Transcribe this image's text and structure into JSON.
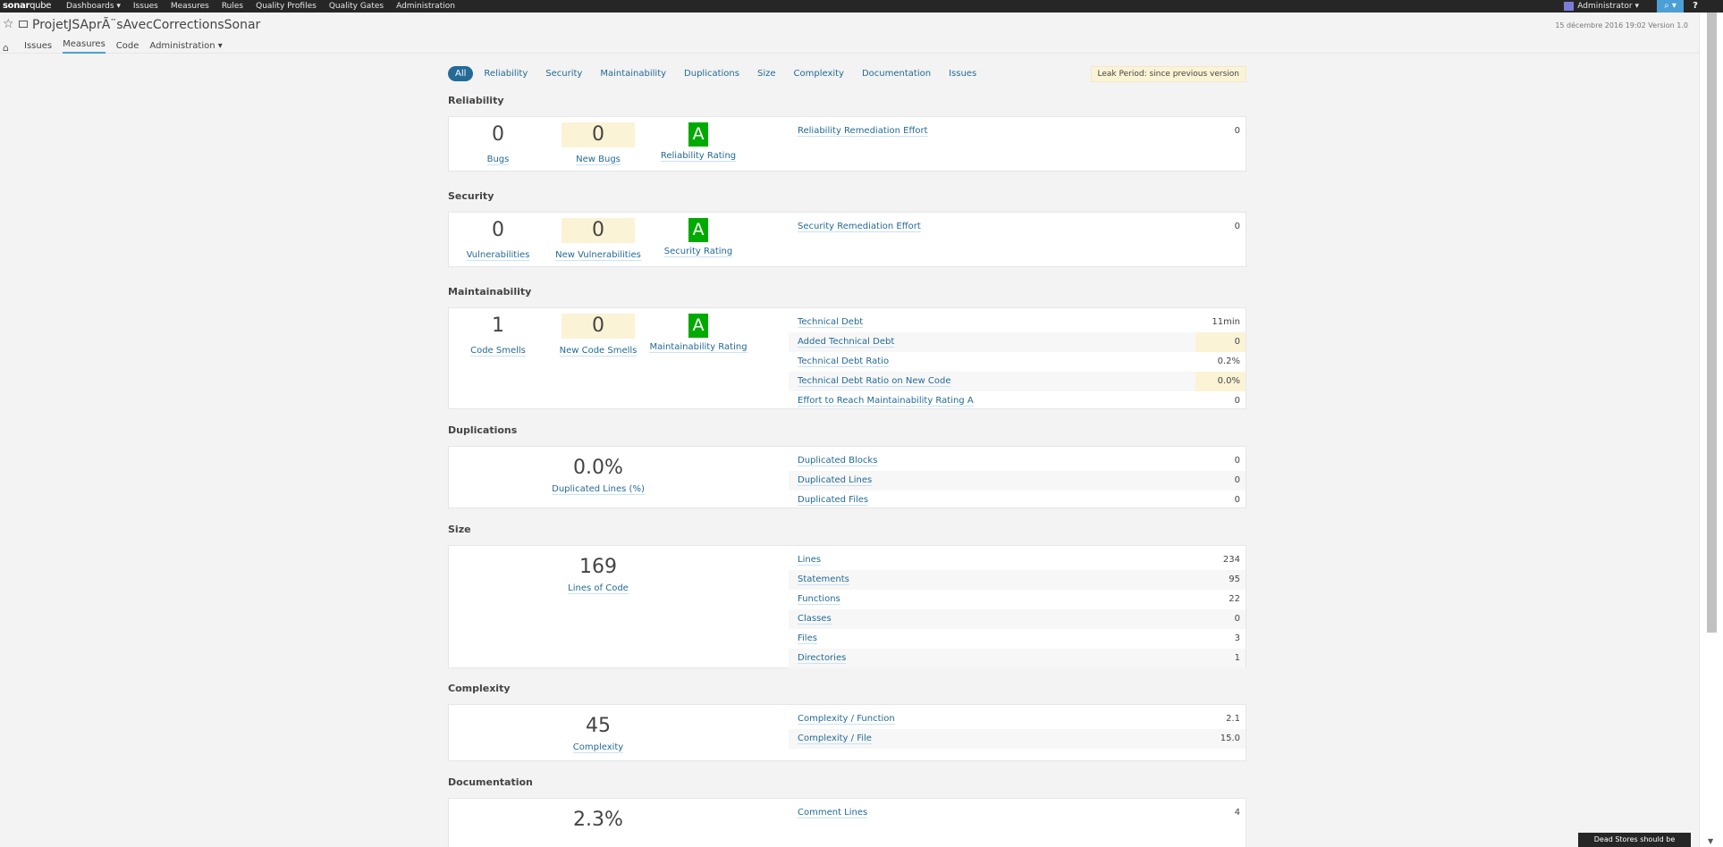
{
  "topnav": {
    "logo_a": "sonar",
    "logo_b": "qube",
    "menu": [
      "Dashboards ▾",
      "Issues",
      "Measures",
      "Rules",
      "Quality Profiles",
      "Quality Gates",
      "Administration"
    ],
    "user": "Administrator ▾",
    "search": "⌕ ▾",
    "help": "?"
  },
  "project": {
    "title": "ProjetJSAprÃ¨sAvecCorrectionsSonar",
    "meta": "15 décembre 2016 19:02   Version 1.0",
    "nav": [
      "Issues",
      "Measures",
      "Code",
      "Administration ▾"
    ]
  },
  "tabs": [
    "All",
    "Reliability",
    "Security",
    "Maintainability",
    "Duplications",
    "Size",
    "Complexity",
    "Documentation",
    "Issues"
  ],
  "leak_period": "Leak Period: since previous version",
  "reliability": {
    "title": "Reliability",
    "bugs": "0",
    "bugs_label": "Bugs",
    "new_bugs": "0",
    "new_bugs_label": "New Bugs",
    "rating": "A",
    "rating_label": "Reliability Rating",
    "rows": [
      {
        "label": "Reliability Remediation Effort",
        "value": "0"
      }
    ]
  },
  "security": {
    "title": "Security",
    "vuln": "0",
    "vuln_label": "Vulnerabilities",
    "new_vuln": "0",
    "new_vuln_label": "New Vulnerabilities",
    "rating": "A",
    "rating_label": "Security Rating",
    "rows": [
      {
        "label": "Security Remediation Effort",
        "value": "0"
      }
    ]
  },
  "maintainability": {
    "title": "Maintainability",
    "smells": "1",
    "smells_label": "Code Smells",
    "new_smells": "0",
    "new_smells_label": "New Code Smells",
    "rating": "A",
    "rating_label": "Maintainability Rating",
    "rows": [
      {
        "label": "Technical Debt",
        "value": "11min"
      },
      {
        "label": "Added Technical Debt",
        "value": "0"
      },
      {
        "label": "Technical Debt Ratio",
        "value": "0.2%"
      },
      {
        "label": "Technical Debt Ratio on New Code",
        "value": "0.0%"
      },
      {
        "label": "Effort to Reach Maintainability Rating A",
        "value": "0"
      }
    ]
  },
  "duplications": {
    "title": "Duplications",
    "big": "0.0%",
    "big_label": "Duplicated Lines (%)",
    "rows": [
      {
        "label": "Duplicated Blocks",
        "value": "0"
      },
      {
        "label": "Duplicated Lines",
        "value": "0"
      },
      {
        "label": "Duplicated Files",
        "value": "0"
      }
    ]
  },
  "size": {
    "title": "Size",
    "big": "169",
    "big_label": "Lines of Code",
    "rows": [
      {
        "label": "Lines",
        "value": "234"
      },
      {
        "label": "Statements",
        "value": "95"
      },
      {
        "label": "Functions",
        "value": "22"
      },
      {
        "label": "Classes",
        "value": "0"
      },
      {
        "label": "Files",
        "value": "3"
      },
      {
        "label": "Directories",
        "value": "1"
      }
    ]
  },
  "complexity": {
    "title": "Complexity",
    "big": "45",
    "big_label": "Complexity",
    "rows": [
      {
        "label": "Complexity / Function",
        "value": "2.1"
      },
      {
        "label": "Complexity / File",
        "value": "15.0"
      }
    ]
  },
  "documentation": {
    "title": "Documentation",
    "big": "2.3%",
    "rows": [
      {
        "label": "Comment Lines",
        "value": "4"
      }
    ]
  },
  "toast": "Dead Stores should be removed ×"
}
